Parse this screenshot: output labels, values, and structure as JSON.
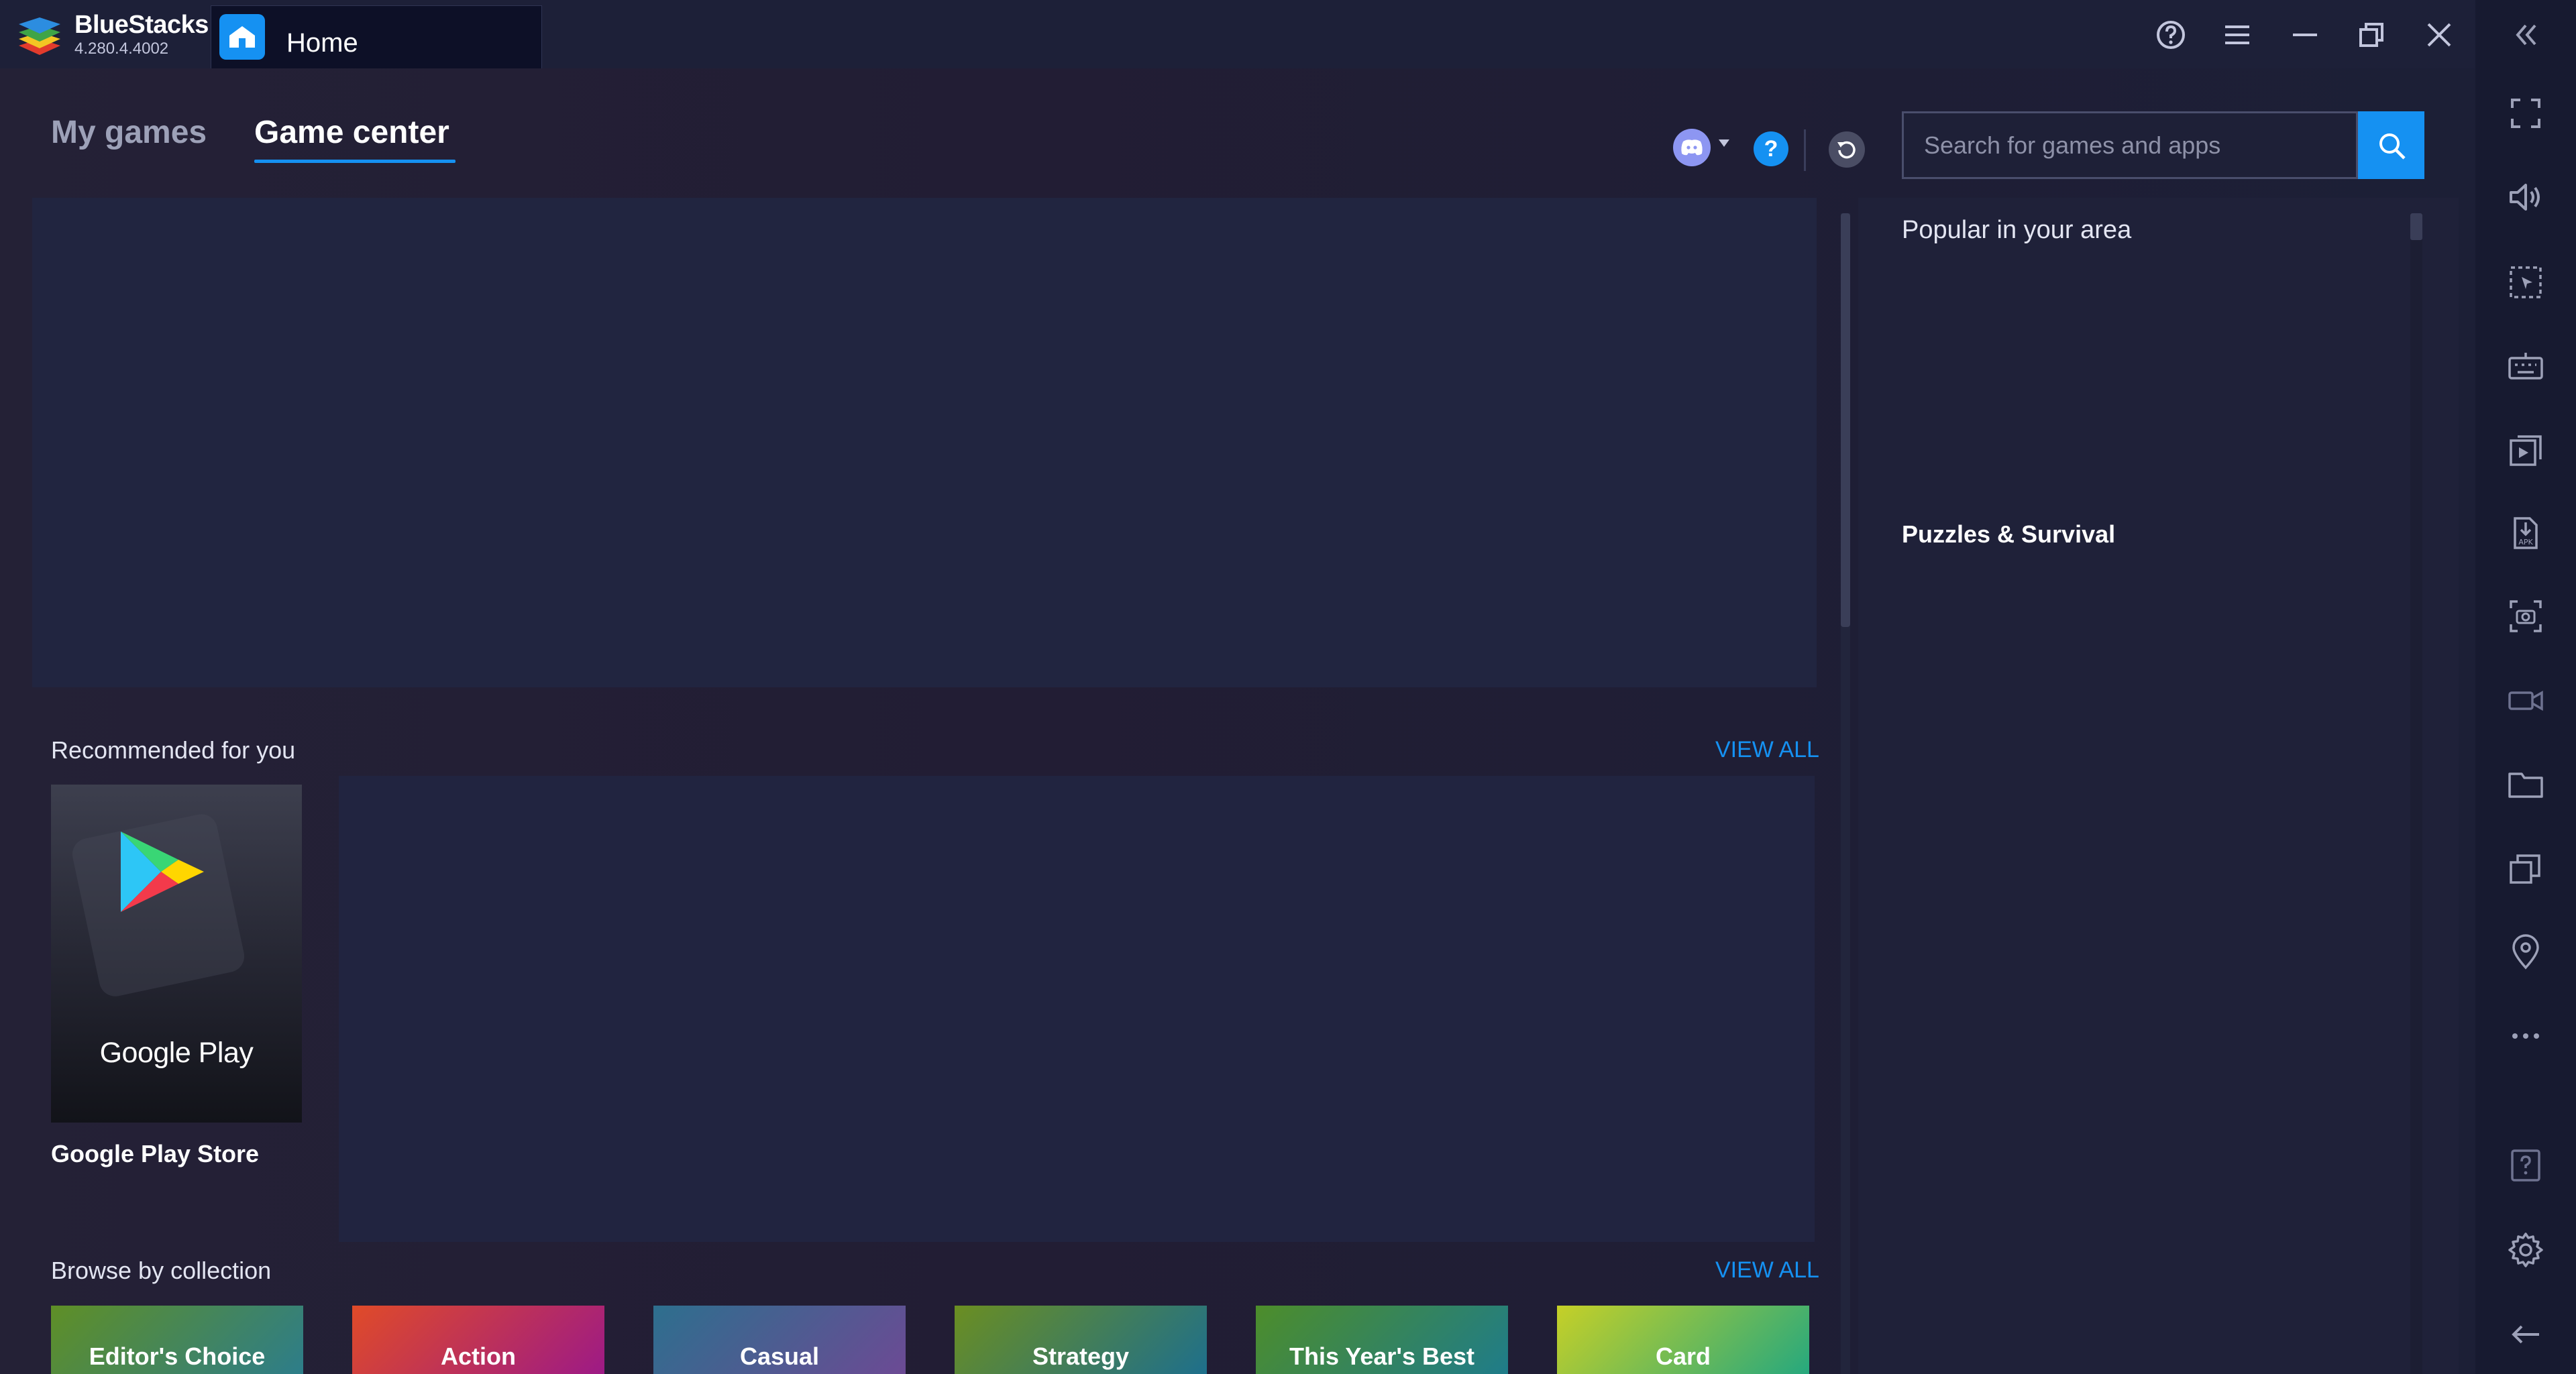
{
  "app": {
    "name": "BlueStacks",
    "version": "4.280.4.4002",
    "active_tab": "Home"
  },
  "nav": {
    "tabs": [
      {
        "label": "My games",
        "active": false
      },
      {
        "label": "Game center",
        "active": true
      }
    ]
  },
  "search": {
    "placeholder": "Search for games and apps",
    "value": ""
  },
  "popular": {
    "title": "Popular in your area",
    "games": [
      "Puzzles & Survival"
    ]
  },
  "recommended": {
    "title": "Recommended for you",
    "view_all": "VIEW ALL",
    "apps": [
      {
        "name": "Google Play Store",
        "brand_text": "Google Play"
      }
    ]
  },
  "collections": {
    "title": "Browse by collection",
    "view_all": "VIEW ALL",
    "items": [
      "Editor's Choice",
      "Action",
      "Casual",
      "Strategy",
      "This Year's Best",
      "Card"
    ]
  },
  "icons": {
    "titlebar": [
      "help-circle-icon",
      "menu-icon",
      "minimize-icon",
      "restore-icon",
      "close-icon"
    ],
    "side_toolbar": [
      "collapse-sidebar-icon",
      "fullscreen-icon",
      "volume-icon",
      "pointer-selection-icon",
      "keyboard-icon",
      "media-manager-icon",
      "install-apk-icon",
      "screenshot-icon",
      "record-video-icon",
      "folder-icon",
      "multi-instance-icon",
      "location-icon",
      "more-icon",
      "help-icon",
      "settings-icon",
      "back-icon"
    ]
  },
  "colors": {
    "accent": "#1591f2",
    "background": "#1c1e33",
    "titlebar": "#1d2038",
    "discord": "#8d96f2"
  }
}
